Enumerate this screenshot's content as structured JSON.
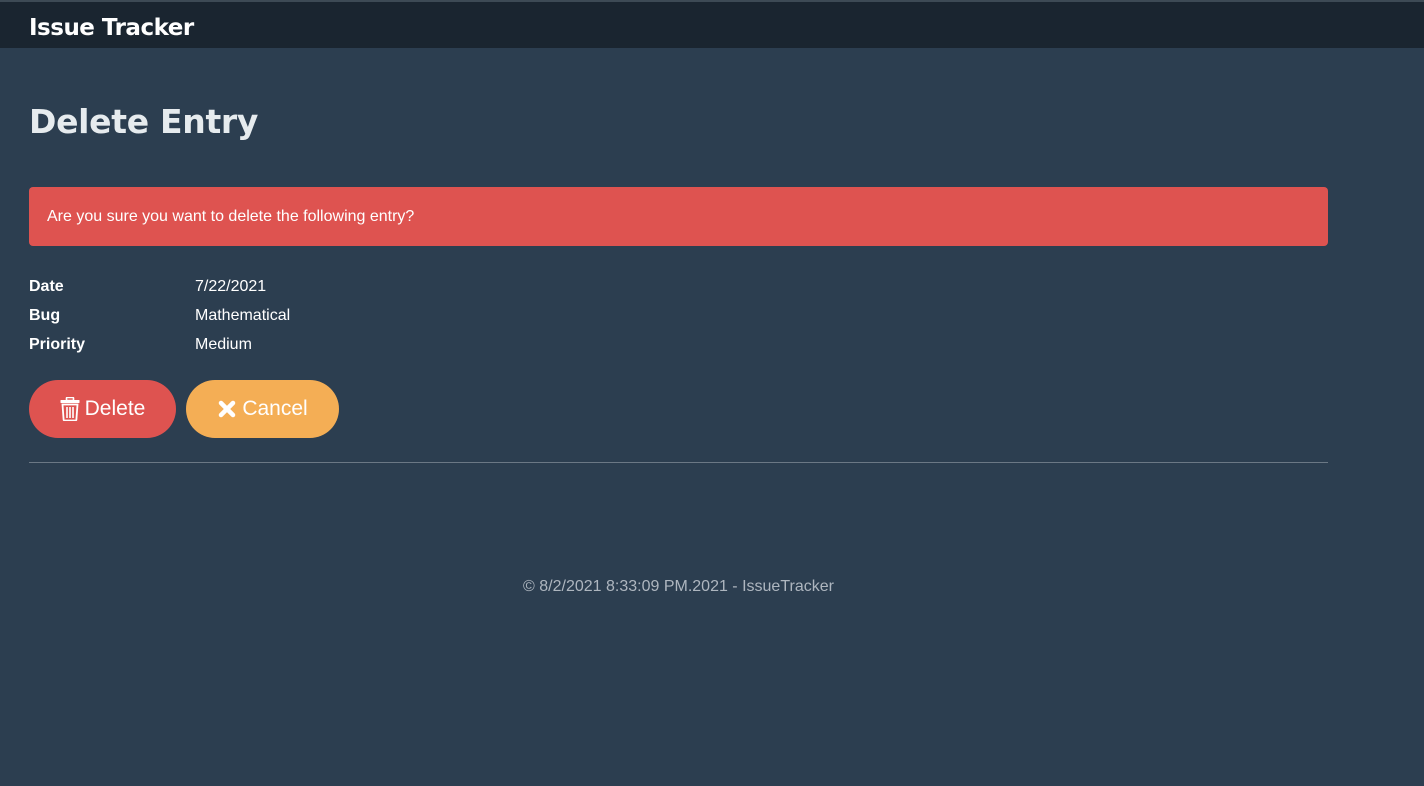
{
  "navbar": {
    "brand": "Issue Tracker"
  },
  "page": {
    "title": "Delete Entry"
  },
  "alert": {
    "message": "Are you sure you want to delete the following entry?"
  },
  "details": [
    {
      "label": "Date",
      "value": "7/22/2021"
    },
    {
      "label": "Bug",
      "value": "Mathematical"
    },
    {
      "label": "Priority",
      "value": "Medium"
    }
  ],
  "actions": {
    "delete_label": "Delete",
    "delete_icon": "trash-icon",
    "cancel_label": "Cancel",
    "cancel_icon": "close-icon"
  },
  "footer": {
    "text": "© 8/2/2021 8:33:09 PM.2021 - IssueTracker"
  },
  "colors": {
    "background": "#2c3e50",
    "navbar": "#1a2530",
    "danger": "#de5350",
    "warning": "#f4ae55"
  }
}
